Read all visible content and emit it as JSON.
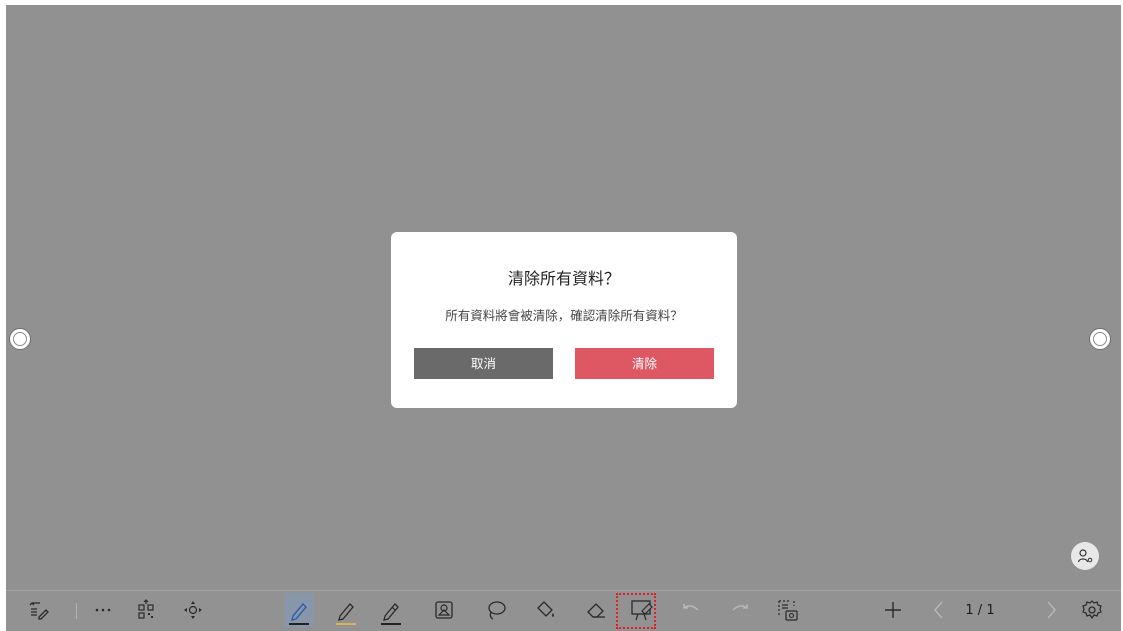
{
  "dialog": {
    "title": "清除所有資料？",
    "message": "所有資料將會被清除，確認清除所有資料？",
    "cancel_label": "取消",
    "confirm_label": "清除"
  },
  "toolbar": {
    "page_indicator": "1 / 1",
    "left_tools": [
      "exit-whiteboard-icon",
      "more-icon",
      "qr-code-icon",
      "move-icon"
    ],
    "drawing_tools": [
      "pen-icon",
      "highlighter-icon",
      "marker-icon",
      "shape-icon",
      "lasso-icon",
      "fill-icon",
      "eraser-icon",
      "clear-board-icon"
    ],
    "history_tools": [
      "undo-icon",
      "redo-icon",
      "screenshot-icon"
    ],
    "right_tools": [
      "add-page-icon",
      "previous-page-icon",
      "next-page-icon",
      "settings-icon"
    ]
  },
  "colors": {
    "overlay": "#919191",
    "dialog_bg": "#ffffff",
    "cancel_button": "#6a6a6a",
    "confirm_button": "#de5864",
    "pen_blue": "#2f5fa8",
    "highlighter_yellow": "#d8b25a",
    "marker_black": "#222222",
    "focus_outline": "#e02020"
  }
}
